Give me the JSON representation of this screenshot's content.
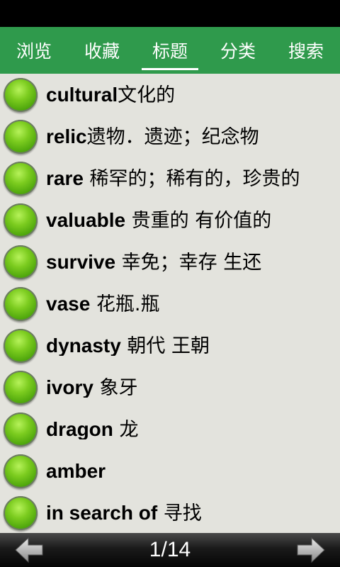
{
  "tabs": [
    {
      "label": "浏览",
      "active": false
    },
    {
      "label": "收藏",
      "active": false
    },
    {
      "label": "标题",
      "active": true
    },
    {
      "label": "分类",
      "active": false
    },
    {
      "label": "搜索",
      "active": false
    }
  ],
  "entries": [
    {
      "word": "cultural",
      "meaning": "文化的"
    },
    {
      "word": "relic",
      "meaning": "遗物．遗迹；纪念物"
    },
    {
      "word": "rare",
      "meaning": " 稀罕的；稀有的，珍贵的"
    },
    {
      "word": "valuable",
      "meaning": " 贵重的 有价值的"
    },
    {
      "word": "survive",
      "meaning": " 幸免；幸存 生还"
    },
    {
      "word": "vase",
      "meaning": " 花瓶.瓶"
    },
    {
      "word": "dynasty",
      "meaning": " 朝代 王朝"
    },
    {
      "word": "ivory",
      "meaning": " 象牙"
    },
    {
      "word": "dragon",
      "meaning": " 龙"
    },
    {
      "word": "amber",
      "meaning": ""
    },
    {
      "word": "in search of",
      "meaning": " 寻找"
    }
  ],
  "footer": {
    "page_indicator": "1/14"
  },
  "icons": {
    "list_bullet": "green-ball-icon",
    "prev": "arrow-left-icon",
    "next": "arrow-right-icon"
  },
  "colors": {
    "tab_bar": "#2f9a4c",
    "list_background": "#e3e3dd",
    "bullet": "#5cb317"
  }
}
